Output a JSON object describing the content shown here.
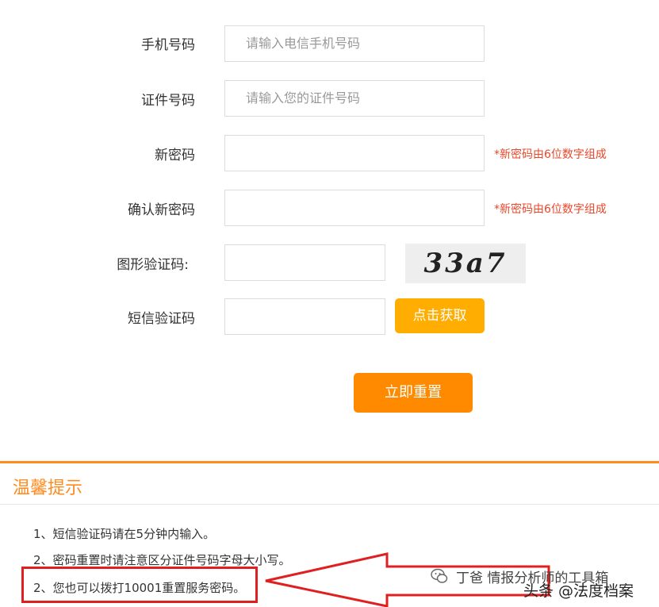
{
  "form": {
    "phone": {
      "label": "手机号码",
      "placeholder": "请输入电信手机号码"
    },
    "id_number": {
      "label": "证件号码",
      "placeholder": "请输入您的证件号码"
    },
    "new_password": {
      "label": "新密码",
      "hint": "*新密码由6位数字组成"
    },
    "confirm_password": {
      "label": "确认新密码",
      "hint": "*新密码由6位数字组成"
    },
    "captcha": {
      "label": "图形验证码:",
      "image_text": "33a7"
    },
    "sms_code": {
      "label": "短信验证码",
      "button": "点击获取"
    },
    "submit": "立即重置"
  },
  "tips": {
    "title": "温馨提示",
    "items": [
      "1、短信验证码请在5分钟内输入。",
      "2、密码重置时请注意区分证件号码字母大小写。",
      "2、您也可以拨打10001重置服务密码。"
    ]
  },
  "watermark": {
    "line1": "丁爸 情报分析师的工具箱",
    "line2": "头条 @法度档案"
  },
  "colors": {
    "accent": "#ff8a00",
    "sms_button": "#ffad00",
    "hint": "#e8472a",
    "annotation": "#e02020"
  }
}
